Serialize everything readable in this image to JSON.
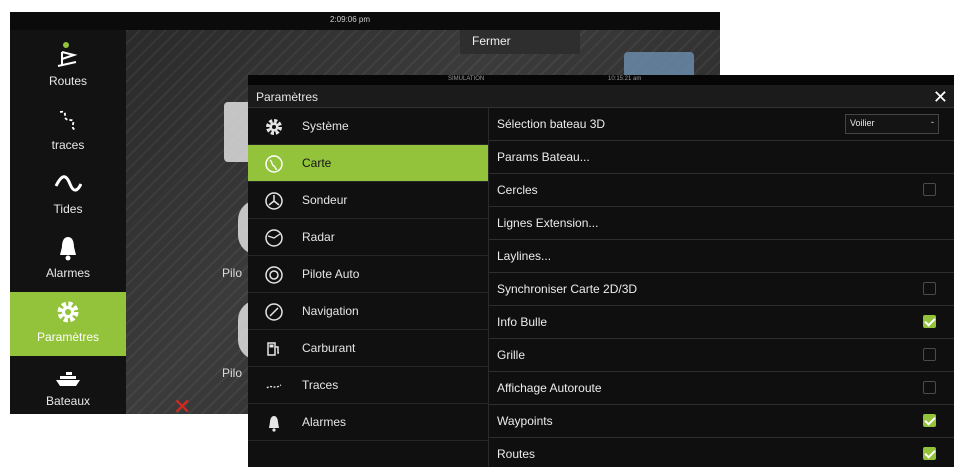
{
  "background": {
    "clock": "2:09:06 pm",
    "close_label": "Fermer",
    "rail": [
      {
        "label": "Routes",
        "icon": "routes-flag-icon"
      },
      {
        "label": "traces",
        "icon": "trails-icon"
      },
      {
        "label": "Tides",
        "icon": "tides-wave-icon"
      },
      {
        "label": "Alarmes",
        "icon": "bell-icon"
      },
      {
        "label": "Paramètres",
        "icon": "gear-icon",
        "active": true
      },
      {
        "label": "Bateaux",
        "icon": "boat-icon"
      }
    ],
    "pilot_labels": [
      "Pilo",
      "Pilo"
    ]
  },
  "dialog": {
    "status_left": "SIMULATION",
    "status_right": "10:15:21 am",
    "title": "Paramètres",
    "close_symbol": "✕",
    "categories": [
      {
        "label": "Système",
        "icon": "gear-icon"
      },
      {
        "label": "Carte",
        "icon": "chart-globe-icon",
        "active": true
      },
      {
        "label": "Sondeur",
        "icon": "sonar-icon"
      },
      {
        "label": "Radar",
        "icon": "radar-icon"
      },
      {
        "label": "Pilote Auto",
        "icon": "autopilot-icon"
      },
      {
        "label": "Navigation",
        "icon": "compass-icon"
      },
      {
        "label": "Carburant",
        "icon": "fuel-pump-icon"
      },
      {
        "label": "Traces",
        "icon": "trails-icon"
      },
      {
        "label": "Alarmes",
        "icon": "bell-icon"
      }
    ],
    "options": [
      {
        "label": "Sélection bateau 3D",
        "type": "select",
        "value": "Voilier"
      },
      {
        "label": "Params Bateau...",
        "type": "link"
      },
      {
        "label": "Cercles",
        "type": "checkbox",
        "checked": false
      },
      {
        "label": "Lignes Extension...",
        "type": "link"
      },
      {
        "label": "Laylines...",
        "type": "link"
      },
      {
        "label": "Synchroniser Carte 2D/3D",
        "type": "checkbox",
        "checked": false
      },
      {
        "label": "Info Bulle",
        "type": "checkbox",
        "checked": true
      },
      {
        "label": "Grille",
        "type": "checkbox",
        "checked": false
      },
      {
        "label": "Affichage Autoroute",
        "type": "checkbox",
        "checked": false
      },
      {
        "label": "Waypoints",
        "type": "checkbox",
        "checked": true
      },
      {
        "label": "Routes",
        "type": "checkbox",
        "checked": true
      }
    ]
  },
  "colors": {
    "accent": "#92c33a",
    "alarm": "#d9271e"
  }
}
